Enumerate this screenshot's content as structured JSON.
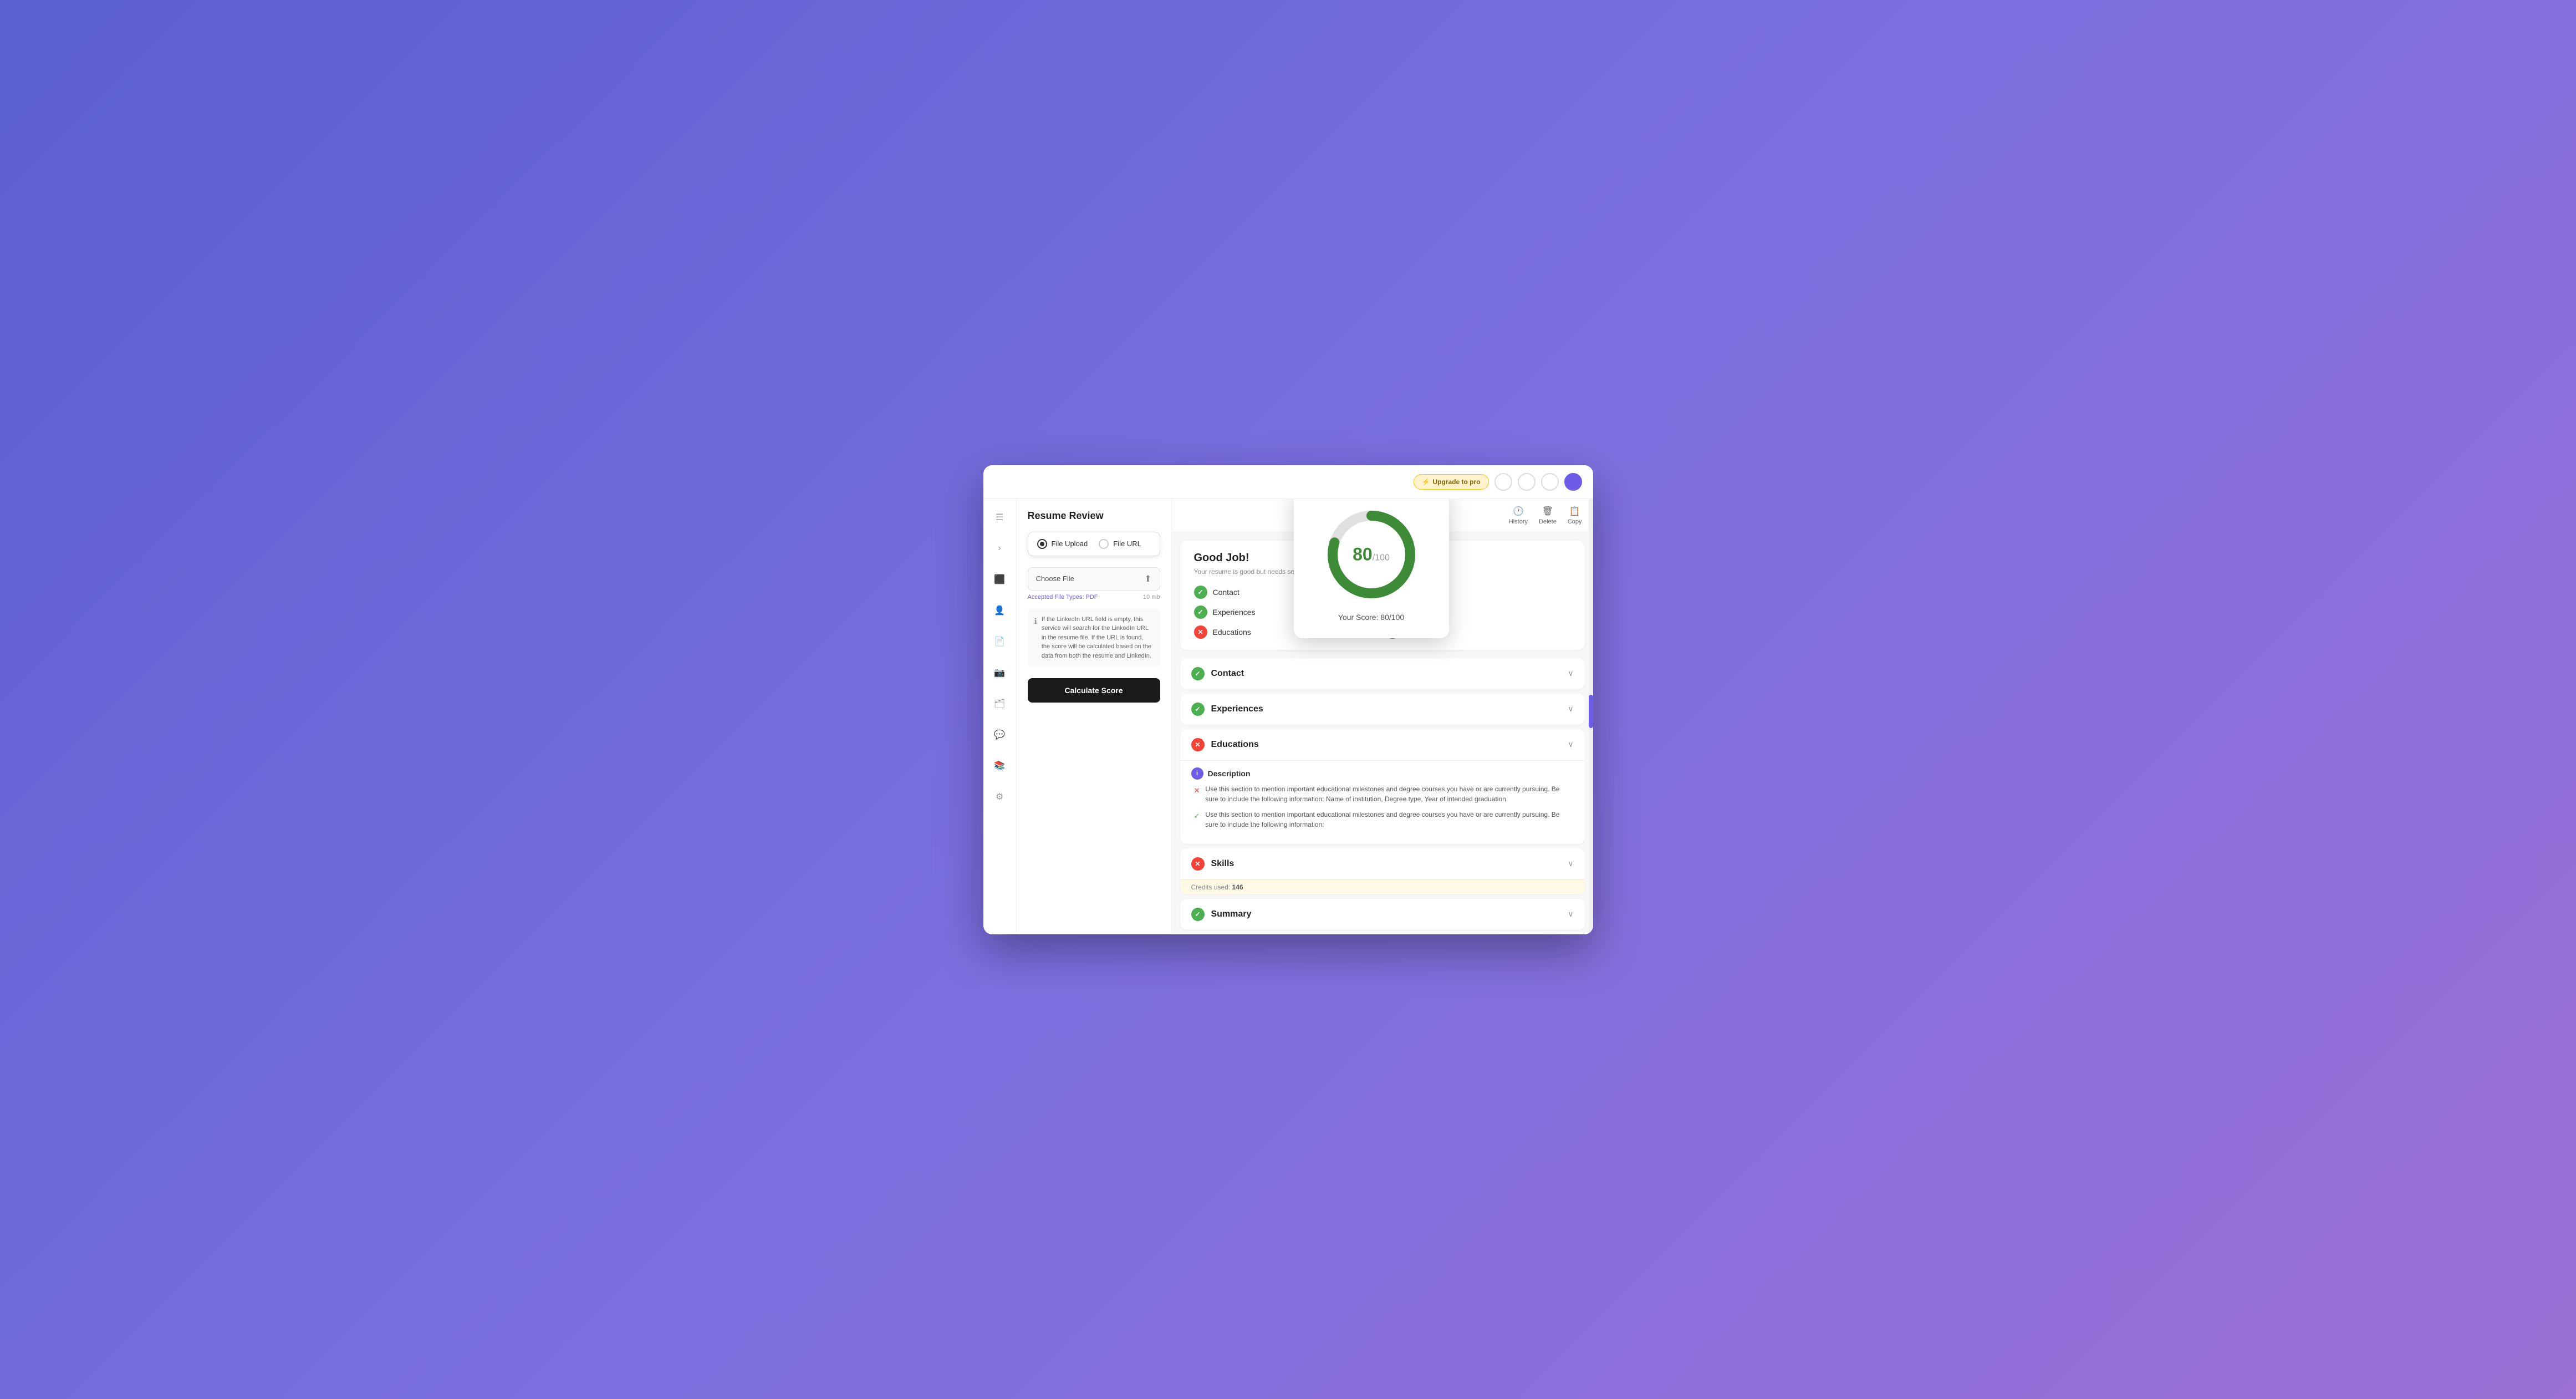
{
  "browser": {
    "upgrade_label": "Upgrade to pro",
    "lightning": "⚡"
  },
  "sidebar": {
    "icons": [
      "☰",
      "›",
      "◧",
      "👤",
      "📄",
      "📷",
      "🗂",
      "💬",
      "📚",
      "⚙"
    ]
  },
  "left_panel": {
    "title": "Resume Review",
    "radio_upload": "File Upload",
    "radio_url": "File URL",
    "file_upload_label": "Choose File",
    "file_types_label": "Accepted File Types: PDF",
    "file_size_label": "10 mb",
    "info_text": "If the LinkedIn URL field is empty, this service will search for the LinkedIn URL in the resume file. If the URL is found, the score will be calculated based on the data from both the resume and LinkedIn.",
    "calc_button": "Calculate Score"
  },
  "score_popup": {
    "score": "80",
    "total": "/100",
    "label": "Your Score: 80/100",
    "arc_pct": 80
  },
  "header_actions": [
    {
      "icon": "🕐",
      "label": "History"
    },
    {
      "icon": "🗑",
      "label": "Delete"
    },
    {
      "icon": "📋",
      "label": "Copy"
    }
  ],
  "good_job": {
    "title": "Good Job!",
    "subtitle": "Your resume is good but needs some work. hopefully we'll help you to know details.",
    "items": [
      {
        "label": "Contact",
        "pass": true
      },
      {
        "label": "Skills",
        "pass": false
      },
      {
        "label": "Experiences",
        "pass": true
      },
      {
        "label": "Summary",
        "pass": true
      },
      {
        "label": "Educations",
        "pass": false
      },
      {
        "label": "Format",
        "pass": true
      }
    ]
  },
  "accordions": [
    {
      "id": "contact",
      "label": "Contact",
      "pass": true,
      "expanded": false
    },
    {
      "id": "experiences",
      "label": "Experiences",
      "pass": true,
      "expanded": false
    },
    {
      "id": "educations",
      "label": "Educations",
      "pass": false,
      "expanded": true,
      "description_label": "Description",
      "feedback": [
        {
          "pass": false,
          "text": "Use this section to mention important educational milestones and degree courses you have or are currently pursuing. Be sure to include the following information: Name of institution, Degree type, Year of intended graduation"
        },
        {
          "pass": true,
          "text": "Use this section to mention important educational milestones and degree courses you have or are currently pursuing. Be sure to include the following information:"
        }
      ]
    },
    {
      "id": "skills",
      "label": "Skills",
      "pass": false,
      "expanded": false
    },
    {
      "id": "summary",
      "label": "Summary",
      "pass": true,
      "expanded": false
    }
  ],
  "credits": {
    "label": "Credits used:",
    "value": "146"
  }
}
